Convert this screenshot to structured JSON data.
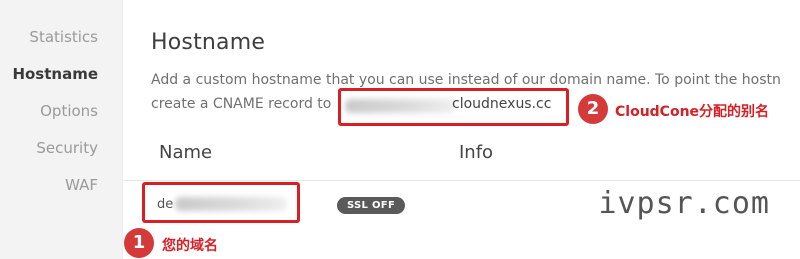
{
  "sidebar": {
    "items": [
      {
        "label": "Statistics"
      },
      {
        "label": "Hostname"
      },
      {
        "label": "Options"
      },
      {
        "label": "Security"
      },
      {
        "label": "WAF"
      }
    ],
    "active": "Hostname"
  },
  "main": {
    "title": "Hostname",
    "description_line1": "Add a custom hostname that you can use instead of our domain name. To point the hostn",
    "description_line2_prefix": "create a CNAME record to",
    "cname_suffix": "cloudnexus.cc",
    "table": {
      "columns": [
        "Name",
        "Info"
      ],
      "rows": [
        {
          "name_prefix": "de",
          "ssl_status": "SSL OFF"
        }
      ]
    }
  },
  "annotations": {
    "marker1_number": "1",
    "marker1_label": "您的域名",
    "marker2_number": "2",
    "marker2_label": "CloudCone分配的别名"
  },
  "watermark": "ivpsr.com",
  "colors": {
    "annotation_red": "#d81f26",
    "badge_bg": "#5a5a5a",
    "sidebar_bg": "#f3f3f3"
  }
}
